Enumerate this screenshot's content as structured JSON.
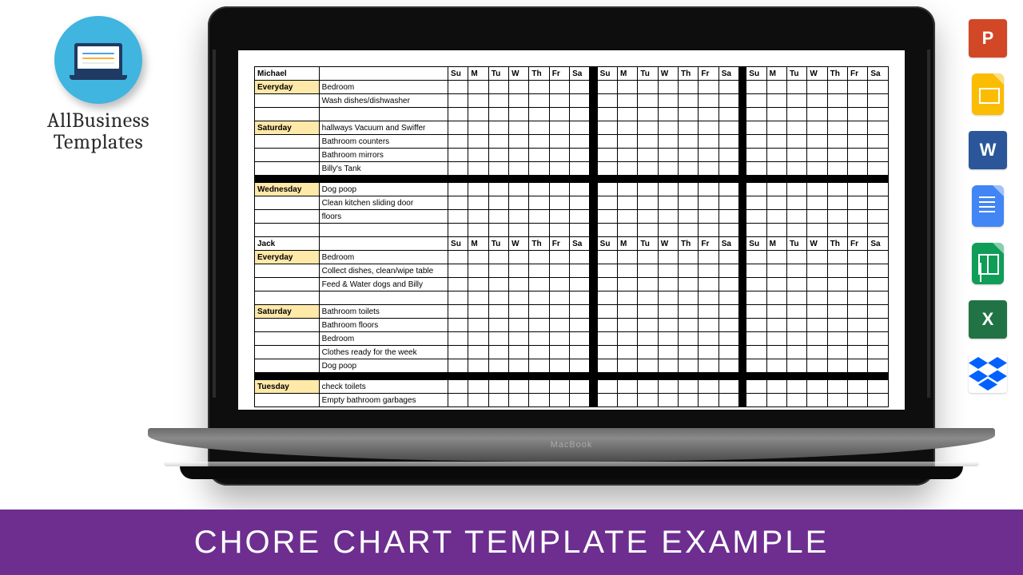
{
  "brand": {
    "line1": "AllBusiness",
    "line2": "Templates"
  },
  "laptop_label": "MacBook",
  "banner_title": "CHORE CHART TEMPLATE EXAMPLE",
  "days": [
    "Su",
    "M",
    "Tu",
    "W",
    "Th",
    "Fr",
    "Sa"
  ],
  "people": [
    {
      "name": "Michael",
      "groups": [
        {
          "heading": "Everyday",
          "tasks": [
            "Bedroom",
            "Wash dishes/dishwasher"
          ]
        },
        {
          "heading": "Saturday",
          "tasks": [
            "hallways Vacuum and Swiffer",
            "Bathroom counters",
            "Bathroom mirrors",
            "Billy's Tank"
          ]
        },
        {
          "heading": "Wednesday",
          "tasks": [
            "Dog poop",
            "Clean kitchen sliding door",
            "floors"
          ]
        }
      ]
    },
    {
      "name": "Jack",
      "groups": [
        {
          "heading": "Everyday",
          "tasks": [
            "Bedroom",
            "Collect dishes, clean/wipe table",
            "Feed & Water dogs and Billy"
          ]
        },
        {
          "heading": "Saturday",
          "tasks": [
            "Bathroom toilets",
            "Bathroom floors",
            "Bedroom",
            "Clothes ready for the week",
            "Dog poop"
          ]
        },
        {
          "heading": "Tuesday",
          "tasks": [
            "check toilets",
            "Empty bathroom garbages"
          ]
        }
      ]
    }
  ],
  "apps": [
    {
      "id": "powerpoint",
      "label": "P",
      "color": "#d24726"
    },
    {
      "id": "google-slides"
    },
    {
      "id": "word",
      "label": "W",
      "color": "#2b579a"
    },
    {
      "id": "google-docs"
    },
    {
      "id": "google-sheets"
    },
    {
      "id": "excel",
      "label": "X",
      "color": "#217346"
    },
    {
      "id": "dropbox",
      "color": "#0061ff"
    }
  ]
}
